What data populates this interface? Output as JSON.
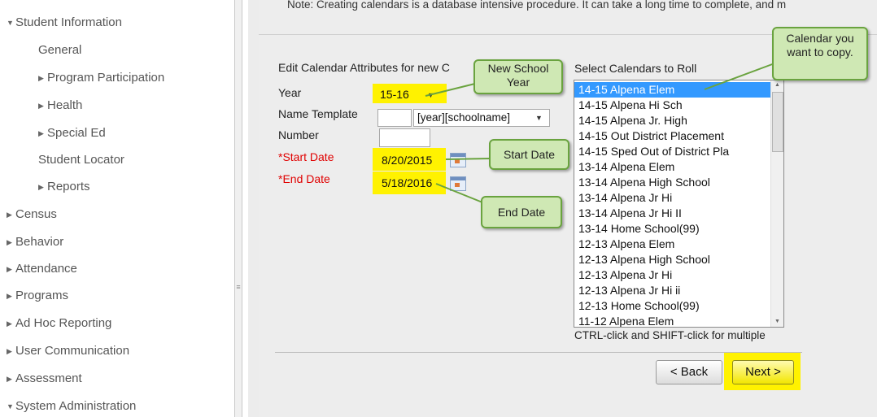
{
  "sidebar": {
    "items": [
      {
        "label": "Student Information",
        "marker": "▼"
      },
      {
        "label": "General",
        "marker": ""
      },
      {
        "label": "Program Participation",
        "marker": "▶"
      },
      {
        "label": "Health",
        "marker": "▶"
      },
      {
        "label": "Special Ed",
        "marker": "▶"
      },
      {
        "label": "Student Locator",
        "marker": ""
      },
      {
        "label": "Reports",
        "marker": "▶"
      },
      {
        "label": "Census",
        "marker": "▶"
      },
      {
        "label": "Behavior",
        "marker": "▶"
      },
      {
        "label": "Attendance",
        "marker": "▶"
      },
      {
        "label": "Programs",
        "marker": "▶"
      },
      {
        "label": "Ad Hoc Reporting",
        "marker": "▶"
      },
      {
        "label": "User Communication",
        "marker": "▶"
      },
      {
        "label": "Assessment",
        "marker": "▶"
      },
      {
        "label": "System Administration",
        "marker": "▼"
      }
    ]
  },
  "note": "Note: Creating calendars is a database intensive procedure. It can take a long time to complete, and m",
  "form": {
    "section_title": "Edit Calendar Attributes for new C",
    "year_label": "Year",
    "year_value": "15-16",
    "name_template_label": "Name Template",
    "name_template_value": "[year][schoolname]",
    "number_label": "Number",
    "start_date_label": "*Start Date",
    "start_date_value": "8/20/2015",
    "end_date_label": "*End Date",
    "end_date_value": "5/18/2016"
  },
  "calendars": {
    "title": "Select Calendars to Roll",
    "items": [
      "14-15 Alpena Elem",
      "14-15 Alpena Hi Sch",
      "14-15 Alpena Jr. High",
      "14-15 Out District Placement",
      "14-15 Sped Out of District Pla",
      "13-14 Alpena Elem",
      "13-14 Alpena High School",
      "13-14 Alpena Jr Hi",
      "13-14 Alpena Jr Hi II",
      "13-14 Home School(99)",
      "12-13 Alpena Elem",
      "12-13 Alpena High School",
      "12-13 Alpena Jr Hi",
      "12-13 Alpena Jr Hi ii",
      "12-13 Home School(99)",
      "11-12 Alpena Elem"
    ],
    "hint": "CTRL-click and SHIFT-click for multiple"
  },
  "buttons": {
    "back": "< Back",
    "next": "Next >"
  },
  "callouts": {
    "new_school_year": "New School Year",
    "calendar_copy": "Calendar you want to copy.",
    "start_date": "Start Date",
    "end_date": "End Date"
  },
  "colors": {
    "highlight": "#fff200",
    "selection": "#3399ff",
    "required": "#e00000",
    "callout_fill": "#cfe8b4",
    "callout_border": "#6aa33f"
  },
  "icons": [
    "calendar-icon",
    "chevron-down-icon",
    "scroll-up-icon",
    "scroll-down-icon",
    "grip-icon"
  ]
}
